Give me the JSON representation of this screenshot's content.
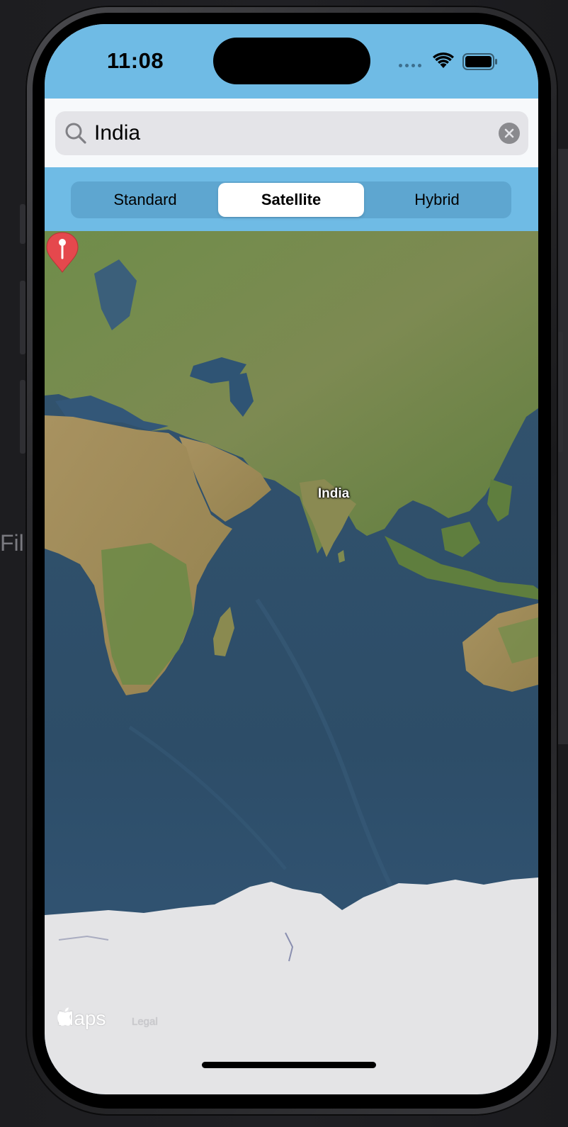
{
  "desktop": {
    "left_fragment": "Fil"
  },
  "status_bar": {
    "time": "11:08",
    "icons": [
      "cellular-dots-icon",
      "wifi-icon",
      "battery-icon"
    ]
  },
  "search": {
    "value": "India",
    "icon": "search-icon",
    "clear_icon": "clear-icon"
  },
  "map_type": {
    "options": [
      "Standard",
      "Satellite",
      "Hybrid"
    ],
    "selected": "Satellite"
  },
  "map": {
    "annotation": {
      "label": "India",
      "icon": "map-pin-icon",
      "color": "#e5484d"
    },
    "attribution": {
      "logo_text": "Maps",
      "legal": "Legal"
    }
  },
  "colors": {
    "header": "#6fbbe5",
    "search_bg": "#f7f9fb",
    "ocean": "#2f4f6b",
    "land": "#6e8a4a",
    "ice": "#e4e4e6"
  }
}
